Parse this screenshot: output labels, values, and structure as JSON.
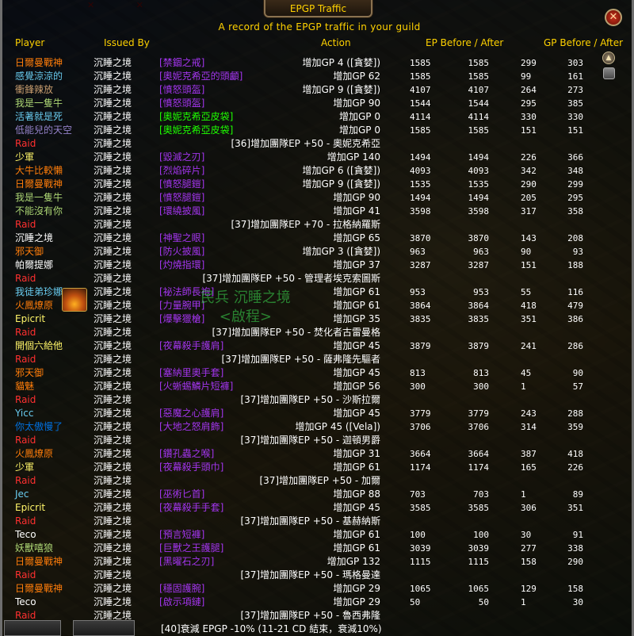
{
  "window": {
    "title": "EPGP Traffic",
    "subtitle": "A record of the EPGP traffic in your guild",
    "close_label": "✕"
  },
  "columns": {
    "player": "Player",
    "issued_by": "Issued By",
    "action": "Action",
    "ep": "EP Before / After",
    "gp": "GP Before / After"
  },
  "overlay": {
    "line1": "民兵 沉睡之境",
    "line2": "<啟程>"
  },
  "colors": {
    "gold": "#ffd200",
    "raid": "#ff3030",
    "guild": "#40ff40",
    "epic": "#a335ee",
    "rare": "#0070dd",
    "uncommon": "#1eff00",
    "white": "#ffffff"
  },
  "rows": [
    {
      "player": "日爾曼戰神",
      "pc": "#ff7d0a",
      "by": "沉睡之境",
      "item": "[禁錮之戒]",
      "ic": "#a335ee",
      "action": "增加GP 4 ([貪婪])",
      "ep1": "1585",
      "ep2": "1585",
      "gp1": "299",
      "gp2": "303"
    },
    {
      "player": "感覺涼涼的",
      "pc": "#69ccf0",
      "by": "沉睡之境",
      "item": "[奧妮克希亞的頭顱]",
      "ic": "#a335ee",
      "action": "增加GP 62",
      "ep1": "1585",
      "ep2": "1585",
      "gp1": "99",
      "gp2": "161"
    },
    {
      "player": "衝鋒辣放",
      "pc": "#c79c6e",
      "by": "沉睡之境",
      "item": "[憤怒頭盔]",
      "ic": "#a335ee",
      "action": "增加GP 9 ([貪婪])",
      "ep1": "4107",
      "ep2": "4107",
      "gp1": "264",
      "gp2": "273"
    },
    {
      "player": "我是一隻牛",
      "pc": "#abd473",
      "by": "沉睡之境",
      "item": "[憤怒頭盔]",
      "ic": "#a335ee",
      "action": "增加GP 90",
      "ep1": "1544",
      "ep2": "1544",
      "gp1": "295",
      "gp2": "385"
    },
    {
      "player": "活著就是死",
      "pc": "#69ccf0",
      "by": "沉睡之境",
      "item": "[奧妮克希亞皮袋]",
      "ic": "#1eff00",
      "action": "增加GP 0",
      "ep1": "4114",
      "ep2": "4114",
      "gp1": "330",
      "gp2": "330"
    },
    {
      "player": "低能兒的天空",
      "pc": "#9482c9",
      "by": "沉睡之境",
      "item": "[奧妮克希亞皮袋]",
      "ic": "#1eff00",
      "action": "增加GP 0",
      "ep1": "1585",
      "ep2": "1585",
      "gp1": "151",
      "gp2": "151"
    },
    {
      "player": "Raid",
      "pc": "#ff3030",
      "by": "沉睡之境",
      "center": "[36]增加團隊EP +50 - 奧妮克希亞"
    },
    {
      "player": "少軍",
      "pc": "#fff569",
      "by": "沉睡之境",
      "item": "[毀滅之刃]",
      "ic": "#a335ee",
      "action": "增加GP 140",
      "ep1": "1494",
      "ep2": "1494",
      "gp1": "226",
      "gp2": "366"
    },
    {
      "player": "大牛比較懶",
      "pc": "#ff7d0a",
      "by": "沉睡之境",
      "item": "[烈焰碎片]",
      "ic": "#a335ee",
      "action": "增加GP 6 ([貪婪])",
      "ep1": "4093",
      "ep2": "4093",
      "gp1": "342",
      "gp2": "348"
    },
    {
      "player": "日爾曼戰神",
      "pc": "#ff7d0a",
      "by": "沉睡之境",
      "item": "[憤怒腿鎧]",
      "ic": "#a335ee",
      "action": "增加GP 9 ([貪婪])",
      "ep1": "1535",
      "ep2": "1535",
      "gp1": "290",
      "gp2": "299"
    },
    {
      "player": "我是一隻牛",
      "pc": "#abd473",
      "by": "沉睡之境",
      "item": "[憤怒腿鎧]",
      "ic": "#a335ee",
      "action": "增加GP 90",
      "ep1": "1494",
      "ep2": "1494",
      "gp1": "205",
      "gp2": "295"
    },
    {
      "player": "不能沒有你",
      "pc": "#abd473",
      "by": "沉睡之境",
      "item": "[環繞披風]",
      "ic": "#a335ee",
      "action": "增加GP 41",
      "ep1": "3598",
      "ep2": "3598",
      "gp1": "317",
      "gp2": "358"
    },
    {
      "player": "Raid",
      "pc": "#ff3030",
      "by": "沉睡之境",
      "center": "[37]增加團隊EP +70 - 拉格納羅斯"
    },
    {
      "player": "沉睡之境",
      "pc": "#ffffff",
      "by": "沉睡之境",
      "item": "[神聖之眼]",
      "ic": "#a335ee",
      "action": "增加GP 65",
      "ep1": "3870",
      "ep2": "3870",
      "gp1": "143",
      "gp2": "208"
    },
    {
      "player": "邪天御",
      "pc": "#ff7d0a",
      "by": "沉睡之境",
      "item": "[防火披風]",
      "ic": "#a335ee",
      "action": "增加GP 3 ([貪婪])",
      "ep1": "963",
      "ep2": "963",
      "gp1": "90",
      "gp2": "93"
    },
    {
      "player": "帕爾提娜",
      "pc": "#ffffff",
      "by": "沉睡之境",
      "item": "[灼燒指環]",
      "ic": "#a335ee",
      "action": "增加GP 37",
      "ep1": "3287",
      "ep2": "3287",
      "gp1": "151",
      "gp2": "188"
    },
    {
      "player": "Raid",
      "pc": "#ff3030",
      "by": "沉睡之境",
      "center": "[37]增加團隊EP +50 - 管理者埃克索圖斯"
    },
    {
      "player": "我徒弟珍娜",
      "pc": "#69ccf0",
      "by": "沉睡之境",
      "item": "[祕法師長袍]",
      "ic": "#a335ee",
      "action": "增加GP 61",
      "ep1": "953",
      "ep2": "953",
      "gp1": "55",
      "gp2": "116"
    },
    {
      "player": "火鳳燎原",
      "pc": "#ff7d0a",
      "by": "沉睡之境",
      "item": "[力量腕甲]",
      "ic": "#a335ee",
      "action": "增加GP 61",
      "ep1": "3864",
      "ep2": "3864",
      "gp1": "418",
      "gp2": "479"
    },
    {
      "player": "Epicrit",
      "pc": "#fff569",
      "by": "沉睡之境",
      "item": "[爆擊獵槍]",
      "ic": "#a335ee",
      "action": "增加GP 35",
      "ep1": "3835",
      "ep2": "3835",
      "gp1": "351",
      "gp2": "386"
    },
    {
      "player": "Raid",
      "pc": "#ff3030",
      "by": "沉睡之境",
      "center": "[37]增加團隊EP +50 - 焚化者古雷曼格"
    },
    {
      "player": "開個六給他",
      "pc": "#fff569",
      "by": "沉睡之境",
      "item": "[夜幕殺手護肩]",
      "ic": "#a335ee",
      "action": "增加GP 45",
      "ep1": "3879",
      "ep2": "3879",
      "gp1": "241",
      "gp2": "286"
    },
    {
      "player": "Raid",
      "pc": "#ff3030",
      "by": "沉睡之境",
      "center": "[37]增加團隊EP +50 - 薩弗隆先驅者"
    },
    {
      "player": "邪天御",
      "pc": "#ff7d0a",
      "by": "沉睡之境",
      "item": "[塞納里奧手套]",
      "ic": "#a335ee",
      "action": "增加GP 45",
      "ep1": "813",
      "ep2": "813",
      "gp1": "45",
      "gp2": "90"
    },
    {
      "player": "貓魅",
      "pc": "#ff7d0a",
      "by": "沉睡之境",
      "item": "[火蜥蜴鱗片短褲]",
      "ic": "#a335ee",
      "action": "增加GP 56",
      "ep1": "300",
      "ep2": "300",
      "gp1": "1",
      "gp2": "57"
    },
    {
      "player": "Raid",
      "pc": "#ff3030",
      "by": "沉睡之境",
      "center": "[37]增加團隊EP +50 - 沙斯拉爾"
    },
    {
      "player": "Yicc",
      "pc": "#69ccf0",
      "by": "沉睡之境",
      "item": "[惡魔之心護肩]",
      "ic": "#a335ee",
      "action": "增加GP 45",
      "ep1": "3779",
      "ep2": "3779",
      "gp1": "243",
      "gp2": "288"
    },
    {
      "player": "你太傲慢了",
      "pc": "#0070de",
      "by": "沉睡之境",
      "item": "[大地之怒肩飾]",
      "ic": "#a335ee",
      "action": "增加GP 45 ([Vela])",
      "ep1": "3706",
      "ep2": "3706",
      "gp1": "314",
      "gp2": "359"
    },
    {
      "player": "Raid",
      "pc": "#ff3030",
      "by": "沉睡之境",
      "center": "[37]增加團隊EP +50 - 迦頓男爵"
    },
    {
      "player": "火鳳燎原",
      "pc": "#ff7d0a",
      "by": "沉睡之境",
      "item": "[鑽孔蟲之喉]",
      "ic": "#a335ee",
      "action": "增加GP 31",
      "ep1": "3664",
      "ep2": "3664",
      "gp1": "387",
      "gp2": "418"
    },
    {
      "player": "少軍",
      "pc": "#fff569",
      "by": "沉睡之境",
      "item": "[夜幕殺手頭巾]",
      "ic": "#a335ee",
      "action": "增加GP 61",
      "ep1": "1174",
      "ep2": "1174",
      "gp1": "165",
      "gp2": "226"
    },
    {
      "player": "Raid",
      "pc": "#ff3030",
      "by": "沉睡之境",
      "center": "[37]增加團隊EP +50 - 加爾"
    },
    {
      "player": "Jec",
      "pc": "#69ccf0",
      "by": "沉睡之境",
      "item": "[巫術匕首]",
      "ic": "#a335ee",
      "action": "增加GP 88",
      "ep1": "703",
      "ep2": "703",
      "gp1": "1",
      "gp2": "89"
    },
    {
      "player": "Epicrit",
      "pc": "#fff569",
      "by": "沉睡之境",
      "item": "[夜幕殺手手套]",
      "ic": "#a335ee",
      "action": "增加GP 45",
      "ep1": "3585",
      "ep2": "3585",
      "gp1": "306",
      "gp2": "351"
    },
    {
      "player": "Raid",
      "pc": "#ff3030",
      "by": "沉睡之境",
      "center": "[37]增加團隊EP +50 - 基赫納斯"
    },
    {
      "player": "Teco",
      "pc": "#ffffff",
      "by": "沉睡之境",
      "item": "[預言短褲]",
      "ic": "#a335ee",
      "action": "增加GP 61",
      "ep1": "100",
      "ep2": "100",
      "gp1": "30",
      "gp2": "91"
    },
    {
      "player": "妖獸嘻狼",
      "pc": "#abd473",
      "by": "沉睡之境",
      "item": "[巨獸之王護腿]",
      "ic": "#a335ee",
      "action": "增加GP 61",
      "ep1": "3039",
      "ep2": "3039",
      "gp1": "277",
      "gp2": "338"
    },
    {
      "player": "日爾曼戰神",
      "pc": "#ff7d0a",
      "by": "沉睡之境",
      "item": "[黑曜石之刃]",
      "ic": "#a335ee",
      "action": "增加GP 132",
      "ep1": "1115",
      "ep2": "1115",
      "gp1": "158",
      "gp2": "290"
    },
    {
      "player": "Raid",
      "pc": "#ff3030",
      "by": "沉睡之境",
      "center": "[37]增加團隊EP +50 - 瑪格曼達"
    },
    {
      "player": "日爾曼戰神",
      "pc": "#ff7d0a",
      "by": "沉睡之境",
      "item": "[穩固護腕]",
      "ic": "#a335ee",
      "action": "增加GP 29",
      "ep1": "1065",
      "ep2": "1065",
      "gp1": "129",
      "gp2": "158"
    },
    {
      "player": "Teco",
      "pc": "#ffffff",
      "by": "沉睡之境",
      "item": "[啟示項鏈]",
      "ic": "#a335ee",
      "action": "增加GP 29",
      "ep1": "50",
      "ep2": "50",
      "gp1": "1",
      "gp2": "30"
    },
    {
      "player": "Raid",
      "pc": "#ff3030",
      "by": "沉睡之境",
      "center": "[37]增加團隊EP +50 - 魯西弗隆"
    },
    {
      "player": "Guild",
      "pc": "#40ff40",
      "by": "沉睡之境",
      "center": "[40]衰減 EPGP -10% (11-21 CD 結束，衰減10%)"
    }
  ]
}
